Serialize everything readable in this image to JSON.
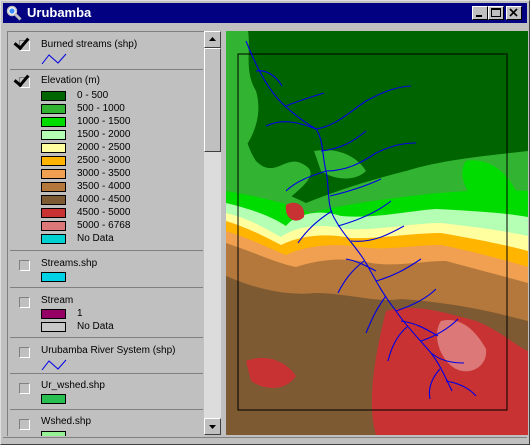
{
  "window": {
    "title": "Urubamba"
  },
  "toc": {
    "layers": [
      {
        "name": "Burned streams (shp)",
        "checked": true
      },
      {
        "name": "Elevation (m)",
        "checked": true
      },
      {
        "name": "Streams.shp",
        "checked": false
      },
      {
        "name": "Stream",
        "checked": false
      },
      {
        "name": "Urubamba River System (shp)",
        "checked": false
      },
      {
        "name": "Ur_wshed.shp",
        "checked": false
      },
      {
        "name": "Wshed.shp",
        "checked": false
      }
    ],
    "elevation_classes": [
      {
        "label": "0 - 500",
        "color": "#006400"
      },
      {
        "label": "500 - 1000",
        "color": "#32b432"
      },
      {
        "label": "1000 - 1500",
        "color": "#00dc00"
      },
      {
        "label": "1500 - 2000",
        "color": "#b4ffb4"
      },
      {
        "label": "2000 - 2500",
        "color": "#ffffa0"
      },
      {
        "label": "2500 - 3000",
        "color": "#ffb400"
      },
      {
        "label": "3000 - 3500",
        "color": "#f0a050"
      },
      {
        "label": "3500 - 4000",
        "color": "#b4783c"
      },
      {
        "label": "4000 - 4500",
        "color": "#7d5a32"
      },
      {
        "label": "4500 - 5000",
        "color": "#c83232"
      },
      {
        "label": "5000 - 6768",
        "color": "#dc7878"
      },
      {
        "label": "No Data",
        "color": "#00d2d2"
      }
    ],
    "streams_swatch_color": "#00d2e6",
    "stream_classes": [
      {
        "label": "1",
        "color": "#960064"
      },
      {
        "label": "No Data",
        "color": "#c8c8c8"
      }
    ],
    "line_symbol_color": "#0000e6",
    "ur_wshed_color": "#28be50",
    "wshed_color": "#96f096"
  }
}
